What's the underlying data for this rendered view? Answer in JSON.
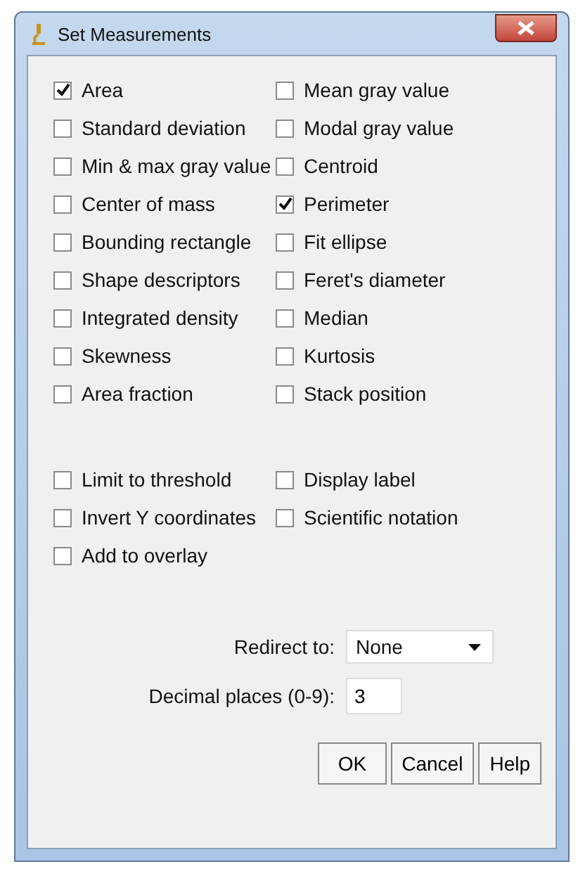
{
  "window": {
    "title": "Set Measurements"
  },
  "measurements": [
    {
      "label": "Area",
      "checked": true
    },
    {
      "label": "Mean gray value",
      "checked": false
    },
    {
      "label": "Standard deviation",
      "checked": false
    },
    {
      "label": "Modal gray value",
      "checked": false
    },
    {
      "label": "Min & max gray value",
      "checked": false
    },
    {
      "label": "Centroid",
      "checked": false
    },
    {
      "label": "Center of mass",
      "checked": false
    },
    {
      "label": "Perimeter",
      "checked": true
    },
    {
      "label": "Bounding rectangle",
      "checked": false
    },
    {
      "label": "Fit ellipse",
      "checked": false
    },
    {
      "label": "Shape descriptors",
      "checked": false
    },
    {
      "label": "Feret's diameter",
      "checked": false
    },
    {
      "label": "Integrated density",
      "checked": false
    },
    {
      "label": "Median",
      "checked": false
    },
    {
      "label": "Skewness",
      "checked": false
    },
    {
      "label": "Kurtosis",
      "checked": false
    },
    {
      "label": "Area fraction",
      "checked": false
    },
    {
      "label": "Stack position",
      "checked": false
    }
  ],
  "options": [
    {
      "label": "Limit to threshold",
      "checked": false
    },
    {
      "label": "Display label",
      "checked": false
    },
    {
      "label": "Invert Y coordinates",
      "checked": false
    },
    {
      "label": "Scientific notation",
      "checked": false
    },
    {
      "label": "Add to overlay",
      "checked": false
    }
  ],
  "redirect": {
    "label": "Redirect to:",
    "value": "None"
  },
  "decimal": {
    "label": "Decimal places (0-9):",
    "value": "3"
  },
  "buttons": [
    "OK",
    "Cancel",
    "Help"
  ]
}
